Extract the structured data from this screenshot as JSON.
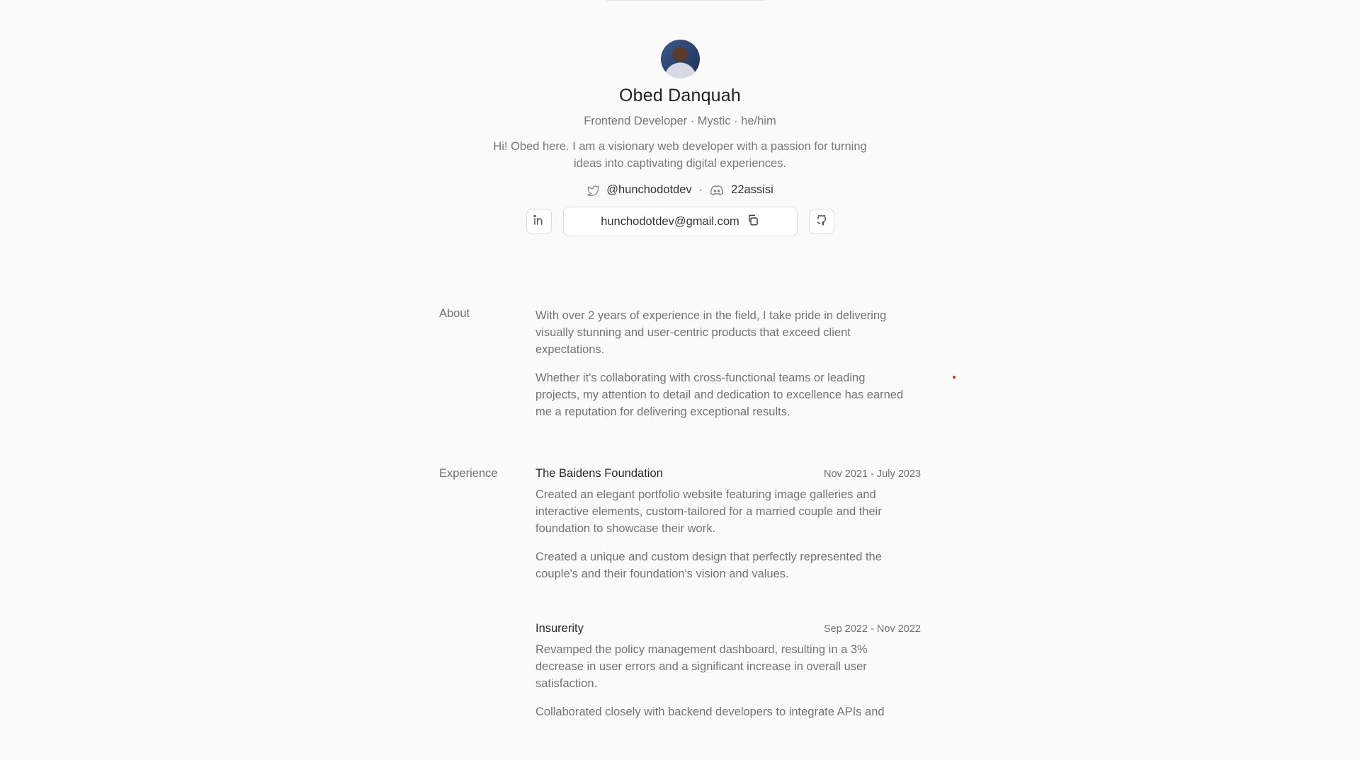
{
  "profile": {
    "name": "Obed Danquah",
    "subtitle": "Frontend Developer · Mystic · he/him",
    "bio": "Hi! Obed here. I am a visionary web developer with a passion for turning ideas into captivating digital experiences.",
    "twitter": "@hunchodotdev",
    "separator": "·",
    "discord": "22assisi",
    "email": "hunchodotdev@gmail.com"
  },
  "icons": {
    "twitter": "twitter-icon",
    "discord": "discord-icon",
    "linkedin": "linkedin-icon",
    "copy": "copy-icon",
    "github": "github-icon"
  },
  "about": {
    "label": "About",
    "paragraphs": [
      "With over 2 years of experience in the field, I take pride in delivering visually stunning and user-centric products that exceed client expectations.",
      "Whether it's collaborating with cross-functional teams or leading projects, my attention to detail and dedication to excellence has earned me a reputation for delivering exceptional results."
    ]
  },
  "experience": {
    "label": "Experience",
    "jobs": [
      {
        "company": "The Baidens Foundation",
        "dates": "Nov 2021 - July 2023",
        "paragraphs": [
          "Created an elegant portfolio website featuring image galleries and interactive elements, custom-tailored for a married couple and their foundation to showcase their work.",
          "Created a unique and custom design that perfectly represented the couple's and their foundation's vision and values."
        ]
      },
      {
        "company": "Insurerity",
        "dates": "Sep 2022 - Nov 2022",
        "paragraphs": [
          "Revamped the policy management dashboard, resulting in a 3% decrease in user errors and a significant increase in overall user satisfaction.",
          "Collaborated closely with backend developers to integrate APIs and"
        ]
      }
    ]
  }
}
